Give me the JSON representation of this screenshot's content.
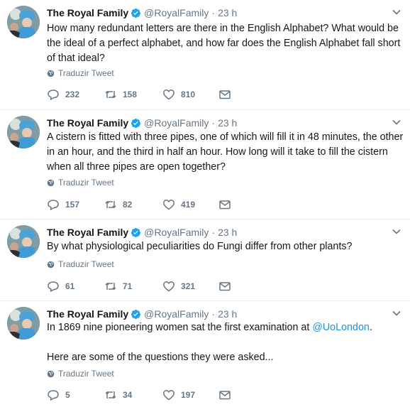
{
  "tweets": [
    {
      "author_name": "The Royal Family",
      "handle": "@RoyalFamily",
      "separator": "·",
      "time": "23 h",
      "text": "How many redundant letters are there in the English Alphabet? What would be the ideal of a perfect alphabet, and how far does the English Alphabet fall short of that ideal?",
      "translate_label": "Traduzir Tweet",
      "replies": "232",
      "retweets": "158",
      "likes": "810"
    },
    {
      "author_name": "The Royal Family",
      "handle": "@RoyalFamily",
      "separator": "·",
      "time": "23 h",
      "text": "A cistern is fitted with three pipes, one of which will fill it in 48 minutes, the other in an hour, and the third in half an hour. How long will it take to fill the cistern when all three pipes are open together?",
      "translate_label": "Traduzir Tweet",
      "replies": "157",
      "retweets": "82",
      "likes": "419"
    },
    {
      "author_name": "The Royal Family",
      "handle": "@RoyalFamily",
      "separator": "·",
      "time": "23 h",
      "text": "By what physiological peculiarities do Fungi differ from other plants?",
      "translate_label": "Traduzir Tweet",
      "replies": "61",
      "retweets": "71",
      "likes": "321"
    },
    {
      "author_name": "The Royal Family",
      "handle": "@RoyalFamily",
      "separator": "·",
      "time": "23 h",
      "text_before_link": "In 1869 nine pioneering women sat the first examination at ",
      "text_link": "@UoLondon",
      "text_after_link": ".",
      "text_second_paragraph": "Here are some of the questions they were asked...",
      "translate_label": "Traduzir Tweet",
      "replies": "5",
      "retweets": "34",
      "likes": "197"
    }
  ],
  "colors": {
    "text": "#14171a",
    "muted": "#657786",
    "link": "#1b95e0",
    "verified": "#1da1f2",
    "divider": "#e6ecf0"
  },
  "icons": {
    "verified": "verified-badge-icon",
    "caret": "chevron-down-icon",
    "translate": "globe-icon",
    "reply": "reply-icon",
    "retweet": "retweet-icon",
    "like": "heart-icon",
    "dm": "envelope-icon"
  }
}
